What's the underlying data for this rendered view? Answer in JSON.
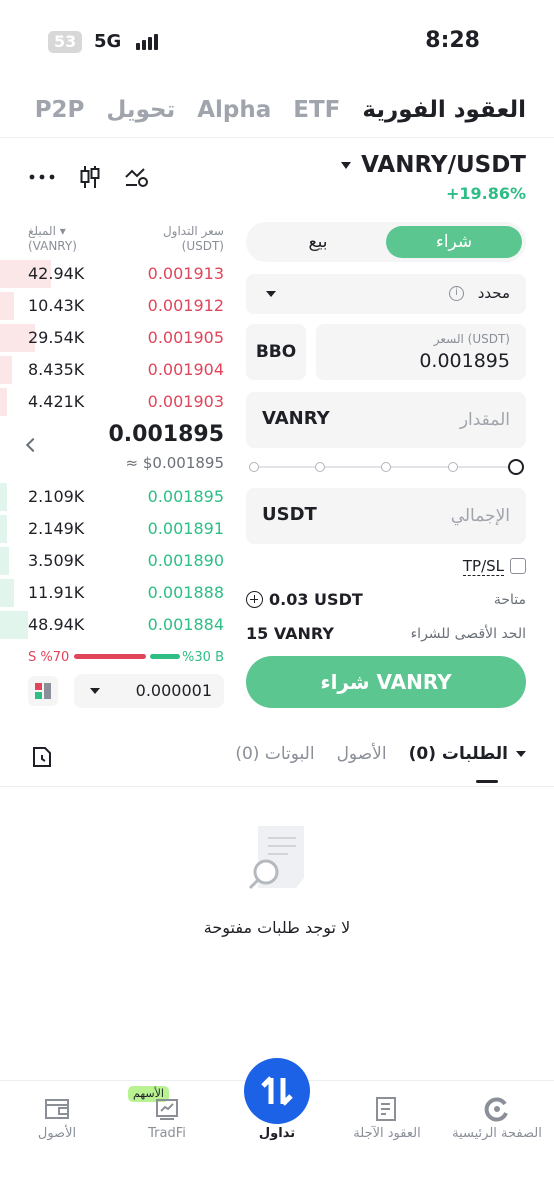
{
  "status_bar": {
    "badge": "53",
    "network": "5G",
    "time": "8:28"
  },
  "top_tabs": [
    {
      "label": "العقود الفورية",
      "active": true
    },
    {
      "label": "ETF",
      "active": false
    },
    {
      "label": "Alpha",
      "active": false
    },
    {
      "label": "تحويل",
      "active": false
    },
    {
      "label": "P2P",
      "active": false
    }
  ],
  "pair": {
    "symbol": "VANRY/USDT",
    "change": "+19.86%"
  },
  "orderbook": {
    "price_header": "سعر التداول",
    "price_unit": "(USDT)",
    "amount_header": "المبلغ",
    "amount_unit": "(VANRY)",
    "asks": [
      {
        "price": "0.001913",
        "amount": "42.94K",
        "depth": 0.22
      },
      {
        "price": "0.001912",
        "amount": "10.43K",
        "depth": 0.06
      },
      {
        "price": "0.001905",
        "amount": "29.54K",
        "depth": 0.15
      },
      {
        "price": "0.001904",
        "amount": "8.435K",
        "depth": 0.05
      },
      {
        "price": "0.001903",
        "amount": "4.421K",
        "depth": 0.03
      }
    ],
    "mid_price": "0.001895",
    "mid_usd": "≈ $0.001895",
    "bids": [
      {
        "price": "0.001895",
        "amount": "2.109K",
        "depth": 0.03
      },
      {
        "price": "0.001891",
        "amount": "2.149K",
        "depth": 0.03
      },
      {
        "price": "0.001890",
        "amount": "3.509K",
        "depth": 0.04
      },
      {
        "price": "0.001888",
        "amount": "11.91K",
        "depth": 0.06
      },
      {
        "price": "0.001884",
        "amount": "48.94K",
        "depth": 0.12
      }
    ],
    "sell_ratio_label": "S %70",
    "buy_ratio_label": "%30 B",
    "sell_ratio": 70,
    "buy_ratio": 30,
    "precision": "0.000001"
  },
  "order_form": {
    "buy_label": "شراء",
    "sell_label": "بيع",
    "order_type": "محدد",
    "bbo_label": "BBO",
    "price_label": "السعر (USDT)",
    "price_value": "0.001895",
    "amount_placeholder": "المقدار",
    "amount_unit": "VANRY",
    "total_placeholder": "الإجمالي",
    "total_unit": "USDT",
    "slider_percent": 100,
    "tpsl_label": "TP/SL",
    "available_label": "متاحة",
    "available_value": "0.03 USDT",
    "max_buy_label": "الحد الأقصى للشراء",
    "max_buy_value": "15 VANRY",
    "submit_label": "شراء VANRY"
  },
  "orders_tabs": {
    "orders_label": "الطلبات (0)",
    "assets_label": "الأصول",
    "bots_label": "البوتات (0)"
  },
  "empty_state": {
    "message": "لا توجد طلبات مفتوحة"
  },
  "bottom_nav": {
    "home": "الصفحة الرئيسية",
    "futures": "العقود الآجلة",
    "trade": "تداول",
    "tradfi": "TradFi",
    "tradfi_badge": "الأسهم",
    "assets": "الأصول"
  },
  "colors": {
    "buy_green": "#5bc690",
    "bid_green": "#2ebd85",
    "ask_red": "#e0455a",
    "fab_blue": "#1b62e6"
  }
}
